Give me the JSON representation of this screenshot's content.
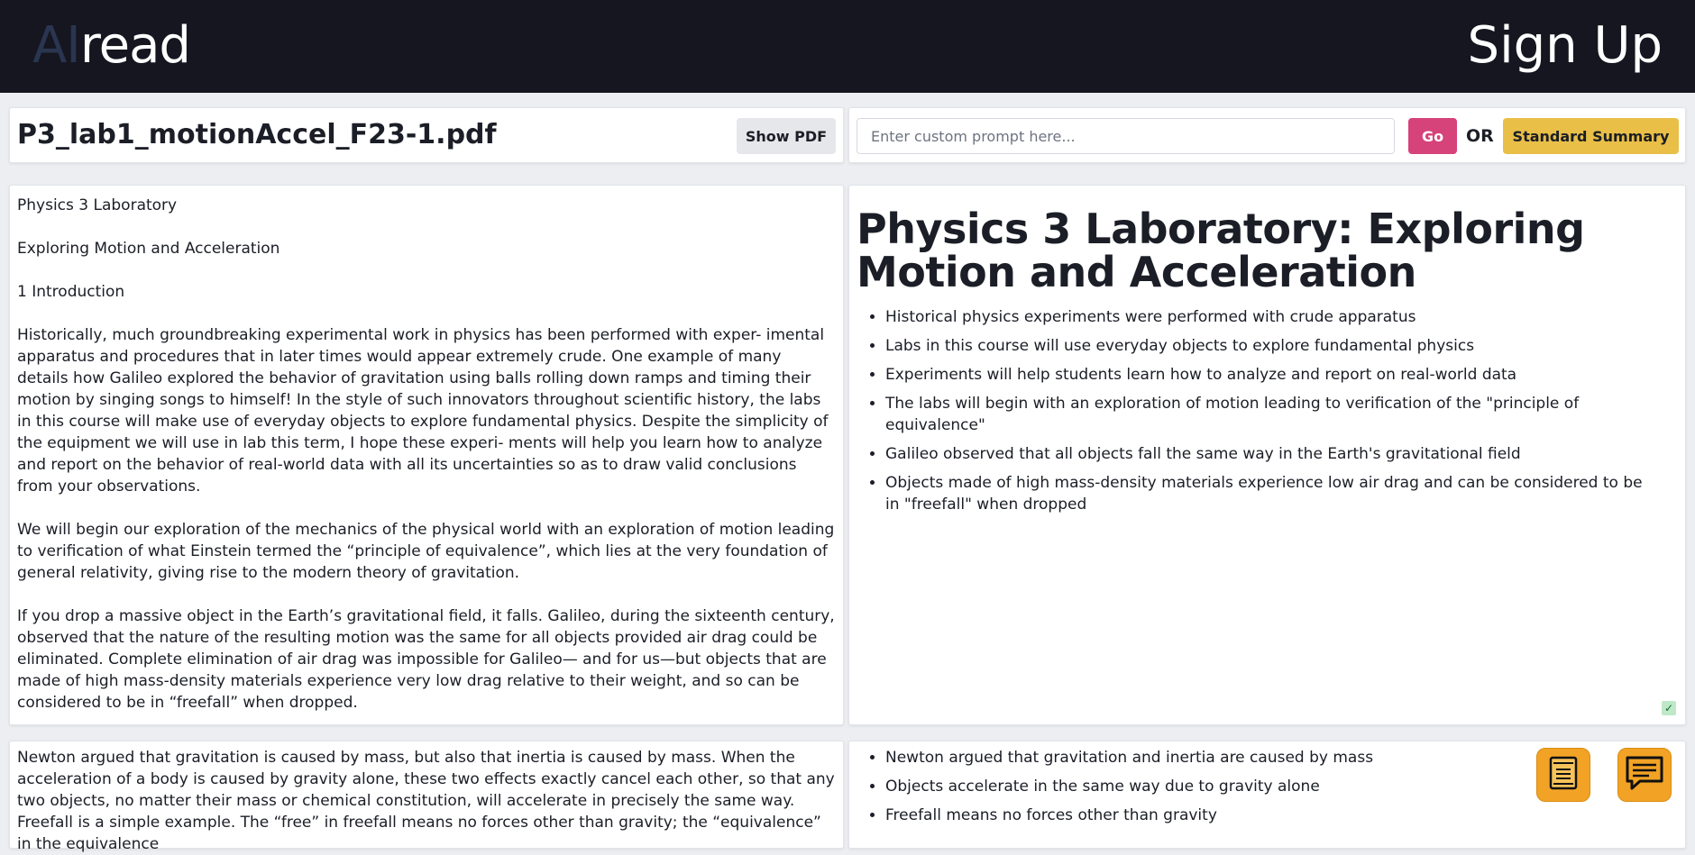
{
  "header": {
    "logo_ai": "AI",
    "logo_read": "read",
    "signup_label": "Sign Up"
  },
  "file": {
    "name": "P3_lab1_motionAccel_F23-1.pdf",
    "show_pdf_label": "Show PDF"
  },
  "prompt": {
    "placeholder": "Enter custom prompt here...",
    "value": "",
    "go_label": "Go",
    "or_label": "OR",
    "standard_label": "Standard Summary"
  },
  "sections": [
    {
      "source": [
        "Physics 3 Laboratory",
        "Exploring Motion and Acceleration",
        "1 Introduction",
        "Historically, much groundbreaking experimental work in physics has been performed with exper- imental apparatus and procedures that in later times would appear extremely crude. One example of many details how Galileo explored the behavior of gravitation using balls rolling down ramps and timing their motion by singing songs to himself! In the style of such innovators throughout scientific history, the labs in this course will make use of everyday objects to explore fundamental physics. Despite the simplicity of the equipment we will use in lab this term, I hope these experi- ments will help you learn how to analyze and report on the behavior of real-world data with all its uncertainties so as to draw valid conclusions from your observations.",
        "We will begin our exploration of the mechanics of the physical world with an exploration of motion leading to verification of what Einstein termed the “principle of equivalence”, which lies at the very foundation of general relativity, giving rise to the modern theory of gravitation.",
        "If you drop a massive object in the Earth’s gravitational field, it falls. Galileo, during the sixteenth century, observed that the nature of the resulting motion was the same for all objects provided air drag could be eliminated. Complete elimination of air drag was impossible for Galileo— and for us—but objects that are made of high mass-density materials experience very low drag relative to their weight, and so can be considered to be in “freefall” when dropped."
      ],
      "summary_title": "Physics 3 Laboratory: Exploring Motion and Acceleration",
      "summary": [
        "Historical physics experiments were performed with crude apparatus",
        "Labs in this course will use everyday objects to explore fundamental physics",
        "Experiments will help students learn how to analyze and report on real-world data",
        "The labs will begin with an exploration of motion leading to verification of the \"principle of equivalence\"",
        "Galileo observed that all objects fall the same way in the Earth's gravitational field",
        "Objects made of high mass-density materials experience low air drag and can be considered to be in \"freefall\" when dropped"
      ],
      "check_mark": "✓"
    },
    {
      "source": [
        "Newton argued that gravitation is caused by mass, but also that inertia is caused by mass. When the acceleration of a body is caused by gravity alone, these two effects exactly cancel each other, so that any two objects, no matter their mass or chemical constitution, will accelerate in precisely the same way. Freefall is a simple example. The “free” in freefall means no forces other than gravity; the “equivalence” in the equivalence"
      ],
      "summary": [
        "Newton argued that gravitation and inertia are caused by mass",
        "Objects accelerate in the same way due to gravity alone",
        "Freefall means no forces other than gravity"
      ]
    }
  ],
  "fab": {
    "doc_icon": "document-icon",
    "chat_icon": "chat-icon",
    "color": "#f2a325"
  }
}
